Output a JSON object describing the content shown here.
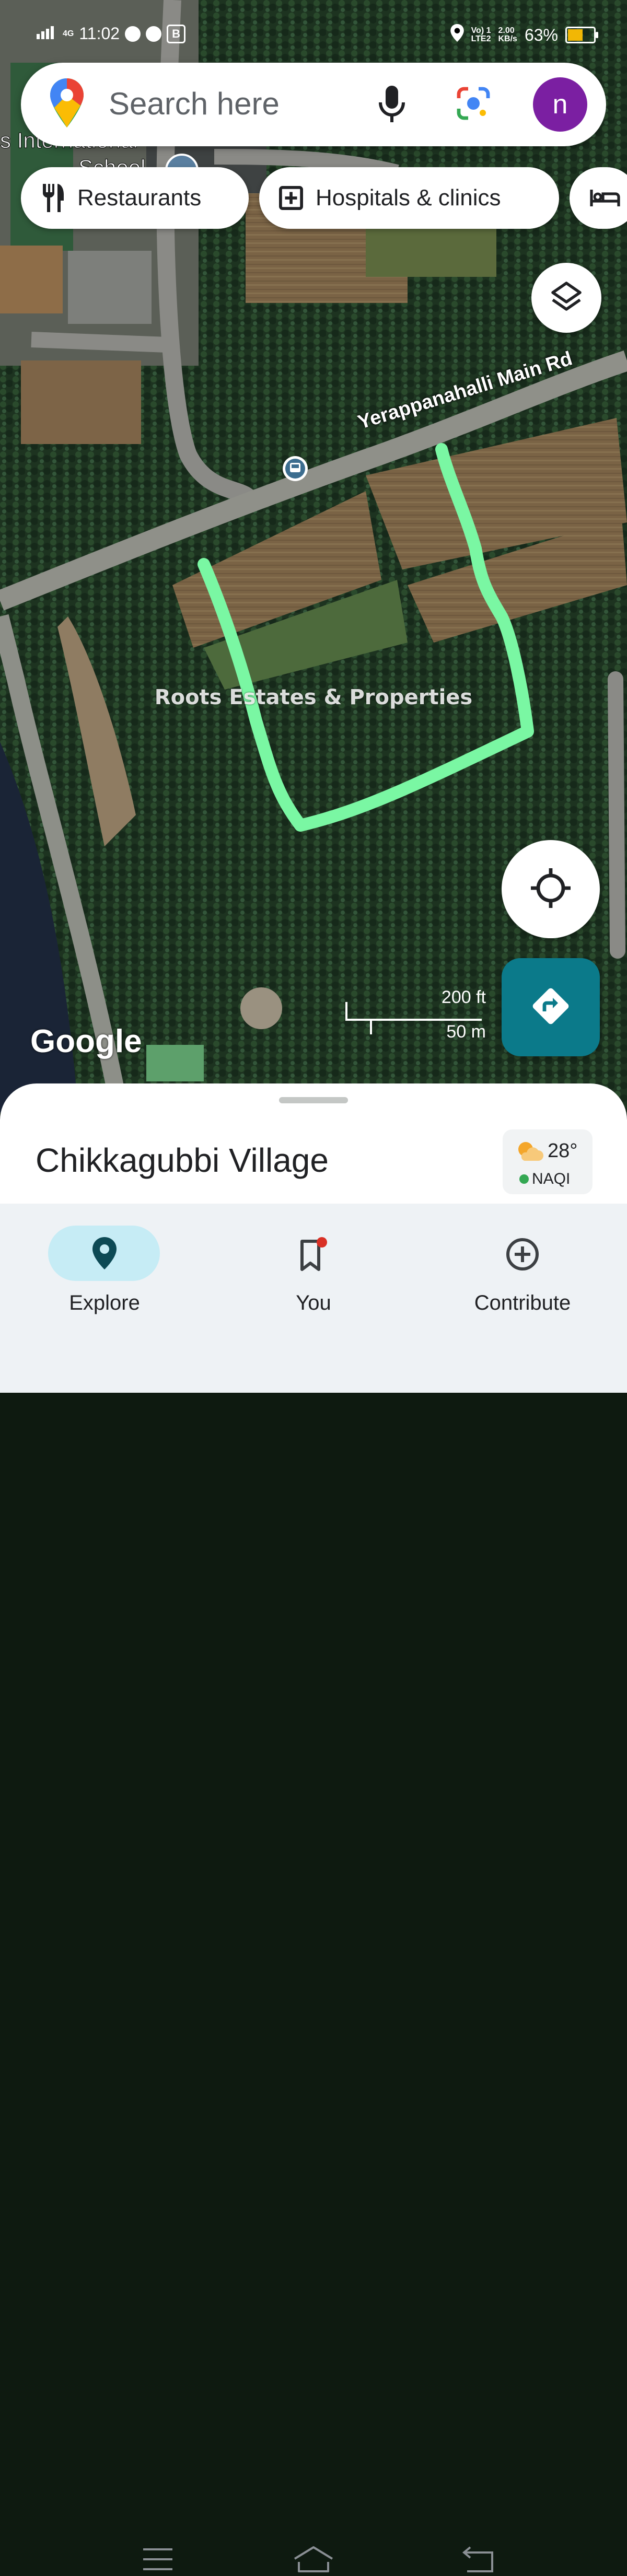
{
  "status_bar": {
    "network": "4G",
    "time": "11:02",
    "volte": "Vo) 1",
    "lte": "LTE2",
    "speed_value": "2.00",
    "speed_unit": "KB/s",
    "battery_percent": "63%",
    "battery_level": 0.63,
    "b_badge": "B"
  },
  "search": {
    "placeholder": "Search here",
    "avatar_letter": "n"
  },
  "chips": [
    {
      "label": "Restaurants",
      "icon": "fork-knife-icon"
    },
    {
      "label": "Hospitals & clinics",
      "icon": "hospital-plus-icon"
    },
    {
      "label": "",
      "icon": "bed-icon"
    }
  ],
  "map": {
    "road_label": "Yerappanahalli Main Rd",
    "watermark": "Roots Estates & Properties",
    "google_logo": "Google",
    "scale_ft": "200 ft",
    "scale_m": "50 m",
    "partial_label_1": "s International",
    "partial_label_2": "School",
    "boundary_color": "#7af7a3"
  },
  "sheet": {
    "place_name": "Chikkagubbi Village",
    "temperature": "28°",
    "aqi_label": "NAQI"
  },
  "nav": [
    {
      "label": "Explore",
      "icon": "pin-icon",
      "active": true
    },
    {
      "label": "You",
      "icon": "bookmark-icon",
      "active": false
    },
    {
      "label": "Contribute",
      "icon": "add-circle-icon",
      "active": false
    }
  ],
  "colors": {
    "accent": "#0b7a8a",
    "active_pill": "#c6ecf5",
    "avatar": "#7b1fa2"
  }
}
